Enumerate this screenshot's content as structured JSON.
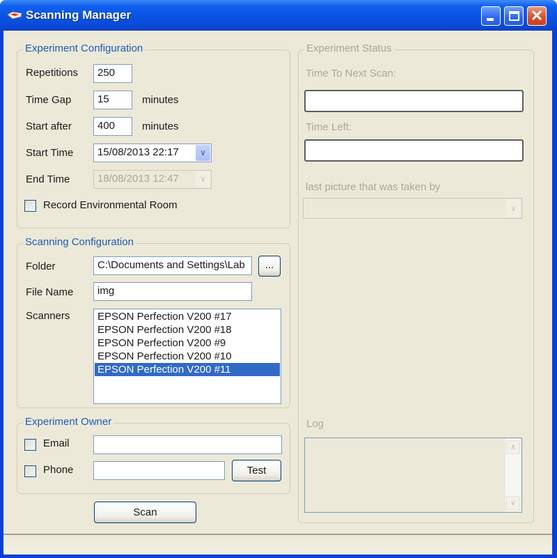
{
  "window": {
    "title": "Scanning Manager",
    "app_icon": "scanner-icon",
    "controls": {
      "minimize": "minimize-icon",
      "maximize": "maximize-icon",
      "close": "close-icon",
      "close_glyph": "✕"
    }
  },
  "experiment_configuration": {
    "title": "Experiment Configuration",
    "repetitions": {
      "label": "Repetitions",
      "value": "250"
    },
    "time_gap": {
      "label": "Time Gap",
      "value": "15",
      "unit": "minutes"
    },
    "start_after": {
      "label": "Start after",
      "value": "400",
      "unit": "minutes"
    },
    "start_time": {
      "label": "Start Time",
      "value": "15/08/2013 22:17"
    },
    "end_time": {
      "label": "End Time",
      "value": "18/08/2013 12:47",
      "disabled": true
    },
    "record_env": {
      "label": "Record Environmental Room",
      "checked": false
    }
  },
  "scanning_configuration": {
    "title": "Scanning Configuration",
    "folder": {
      "label": "Folder",
      "value": "C:\\Documents and Settings\\Lab",
      "browse_label": "..."
    },
    "file_name": {
      "label": "File Name",
      "value": "img"
    },
    "scanners": {
      "label": "Scanners",
      "items": [
        {
          "label": "EPSON Perfection V200 #17",
          "selected": false
        },
        {
          "label": "EPSON Perfection V200 #18",
          "selected": false
        },
        {
          "label": "EPSON Perfection V200 #9",
          "selected": false
        },
        {
          "label": "EPSON Perfection V200 #10",
          "selected": false
        },
        {
          "label": "EPSON Perfection V200 #11",
          "selected": true
        }
      ]
    }
  },
  "experiment_owner": {
    "title": "Experiment Owner",
    "email": {
      "label": "Email",
      "checked": false,
      "value": ""
    },
    "phone": {
      "label": "Phone",
      "checked": false,
      "value": ""
    },
    "test_label": "Test"
  },
  "scan_button": "Scan",
  "experiment_status": {
    "title": "Experiment Status",
    "time_to_next_scan": {
      "label": "Time To Next Scan:",
      "value": ""
    },
    "time_left": {
      "label": "Time Left:",
      "value": ""
    },
    "last_picture": {
      "label": "last picture that was taken by",
      "value": ""
    },
    "log": {
      "label": "Log",
      "value": ""
    }
  },
  "colors": {
    "titlebar": "#0a52e3",
    "group_title": "#1f5bb5",
    "selection": "#316ac5",
    "client_bg": "#ece9d8"
  }
}
